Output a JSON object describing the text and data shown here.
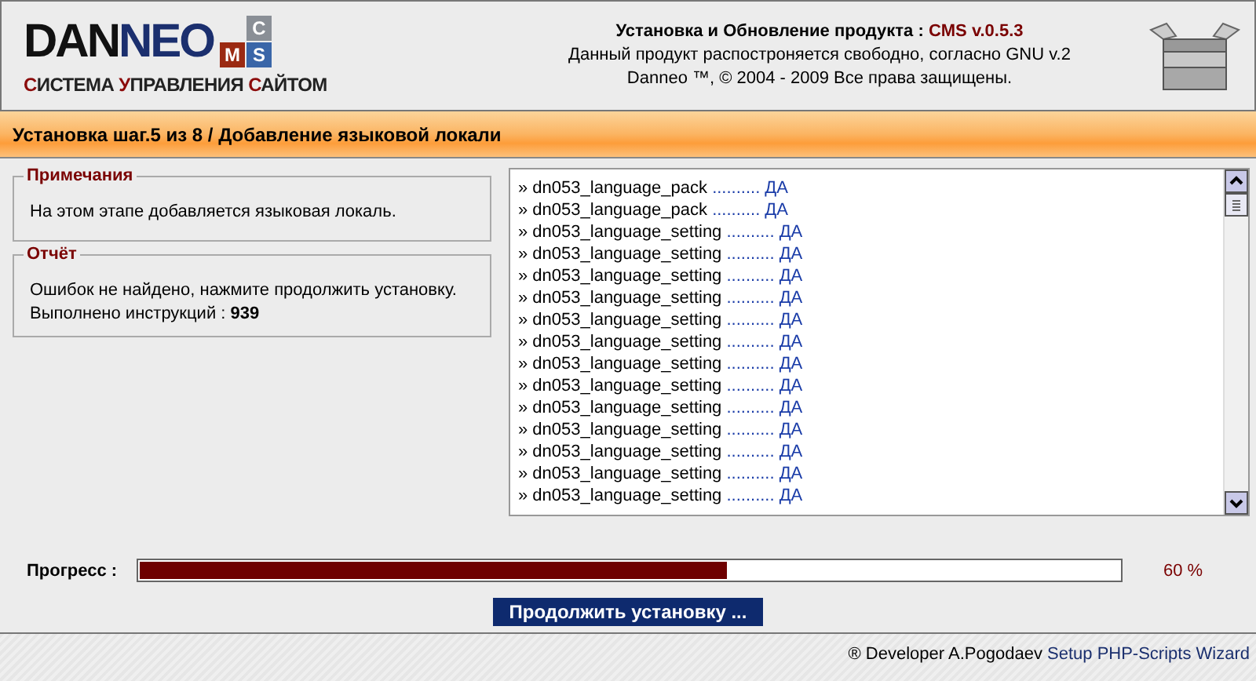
{
  "logo": {
    "dark": "DAN",
    "blue": "NEO",
    "tiles": [
      "C",
      "M",
      "S"
    ],
    "subtitle": "СИСТЕМА УПРАВЛЕНИЯ САЙТОМ"
  },
  "header": {
    "title": "Установка и Обновление продукта :",
    "version": "CMS v.0.5.3",
    "license": "Данный продукт распостроняется свободно, согласно GNU v.2",
    "copyright": "Danneo ™, © 2004 - 2009 Все права защищены."
  },
  "step_bar": "Установка шаг.5 из 8 / Добавление языковой локали",
  "panels": [
    {
      "legend": "Примечания",
      "lines": [
        "На этом этапе добавляется языковая локаль."
      ]
    },
    {
      "legend": "Отчёт",
      "lines": [
        "Ошибок не найдено, нажмите продолжить установку.",
        "Выполнено инструкций : **939**"
      ]
    }
  ],
  "log": [
    {
      "marker": "»",
      "name": "dn053_language_pack",
      "dots": "..........",
      "status": "ДА"
    },
    {
      "marker": "»",
      "name": "dn053_language_pack",
      "dots": "..........",
      "status": "ДА"
    },
    {
      "marker": "»",
      "name": "dn053_language_setting",
      "dots": "..........",
      "status": "ДА"
    },
    {
      "marker": "»",
      "name": "dn053_language_setting",
      "dots": "..........",
      "status": "ДА"
    },
    {
      "marker": "»",
      "name": "dn053_language_setting",
      "dots": "..........",
      "status": "ДА"
    },
    {
      "marker": "»",
      "name": "dn053_language_setting",
      "dots": "..........",
      "status": "ДА"
    },
    {
      "marker": "»",
      "name": "dn053_language_setting",
      "dots": "..........",
      "status": "ДА"
    },
    {
      "marker": "»",
      "name": "dn053_language_setting",
      "dots": "..........",
      "status": "ДА"
    },
    {
      "marker": "»",
      "name": "dn053_language_setting",
      "dots": "..........",
      "status": "ДА"
    },
    {
      "marker": "»",
      "name": "dn053_language_setting",
      "dots": "..........",
      "status": "ДА"
    },
    {
      "marker": "»",
      "name": "dn053_language_setting",
      "dots": "..........",
      "status": "ДА"
    },
    {
      "marker": "»",
      "name": "dn053_language_setting",
      "dots": "..........",
      "status": "ДА"
    },
    {
      "marker": "»",
      "name": "dn053_language_setting",
      "dots": "..........",
      "status": "ДА"
    },
    {
      "marker": "»",
      "name": "dn053_language_setting",
      "dots": "..........",
      "status": "ДА"
    },
    {
      "marker": "»",
      "name": "dn053_language_setting",
      "dots": "..........",
      "status": "ДА"
    }
  ],
  "progress": {
    "label": "Прогресс :",
    "level": 0.6,
    "reading": "60 %"
  },
  "continue_button": "Продолжить установку ...",
  "footer": {
    "credit": "® Developer A.Pogodaev",
    "link": "Setup PHP-Scripts Wizard"
  }
}
